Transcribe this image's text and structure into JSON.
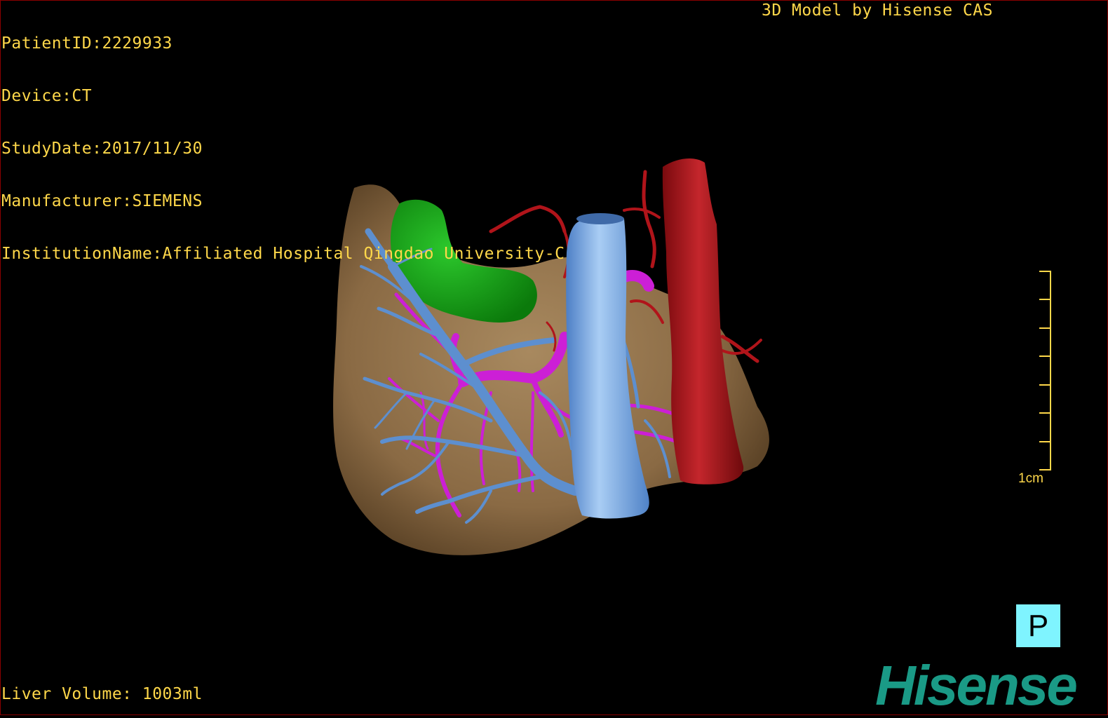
{
  "header": {
    "patient_id": "PatientID:2229933",
    "device": "Device:CT",
    "study_date": "StudyDate:2017/11/30",
    "manufacturer": "Manufacturer:SIEMENS",
    "institution": "InstitutionName:Affiliated Hospital Qingdao University-C"
  },
  "credit": "3D Model by Hisense CAS",
  "footer": {
    "liver_volume": "Liver Volume: 1003ml"
  },
  "scale_bar": {
    "label": "1cm",
    "ticks": 8
  },
  "orientation_marker": {
    "label": "P",
    "color": "#7ff4ff"
  },
  "logo": {
    "text": "Hisense",
    "color": "#1a9a86"
  },
  "colors": {
    "text": "#ffd84a",
    "liver": "#8a6a44",
    "gallbladder": "#14a514",
    "portal_vein": "#cc1fd6",
    "hepatic_vein": "#5d8fcf",
    "vena_cava": "#7fb2ea",
    "aorta": "#b0141a"
  }
}
